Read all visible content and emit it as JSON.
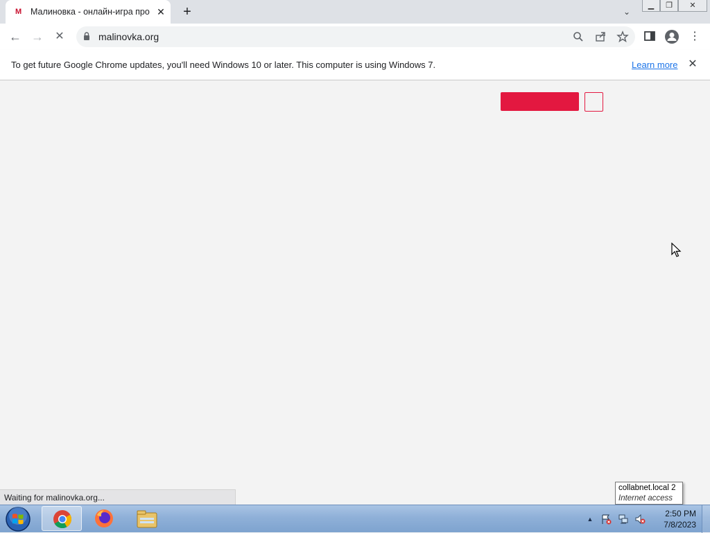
{
  "browser": {
    "tab": {
      "favicon": "M",
      "title": "Малиновка - онлайн-игра про машины",
      "close_glyph": "✕"
    },
    "new_tab_glyph": "+",
    "tab_search_glyph": "⌄",
    "window_controls": {
      "minimize": "▁",
      "restore": "❐",
      "close": "✕"
    },
    "toolbar": {
      "back_glyph": "←",
      "forward_glyph": "→",
      "reload_glyph": "✕",
      "url": "malinovka.org",
      "icons": [
        "search-icon",
        "share-icon",
        "star-icon",
        "side-panel-icon",
        "profile-icon",
        "menu-icon"
      ],
      "menu_glyph": "⋮"
    },
    "infobar": {
      "message": "To get future Google Chrome updates, you'll need Windows 10 or later. This computer is using Windows 7.",
      "link": "Learn more",
      "close_glyph": "✕"
    },
    "status": "Waiting for malinovka.org..."
  },
  "page": {
    "accent_color": "#e31840"
  },
  "tooltip": {
    "line1": "collabnet.local  2",
    "line2": "Internet access"
  },
  "taskbar": {
    "apps": [
      "chrome-icon",
      "firefox-icon",
      "file-explorer-icon"
    ],
    "tray": {
      "show_hidden_glyph": "▲"
    },
    "clock": {
      "time": "2:50 PM",
      "date": "7/8/2023"
    }
  }
}
